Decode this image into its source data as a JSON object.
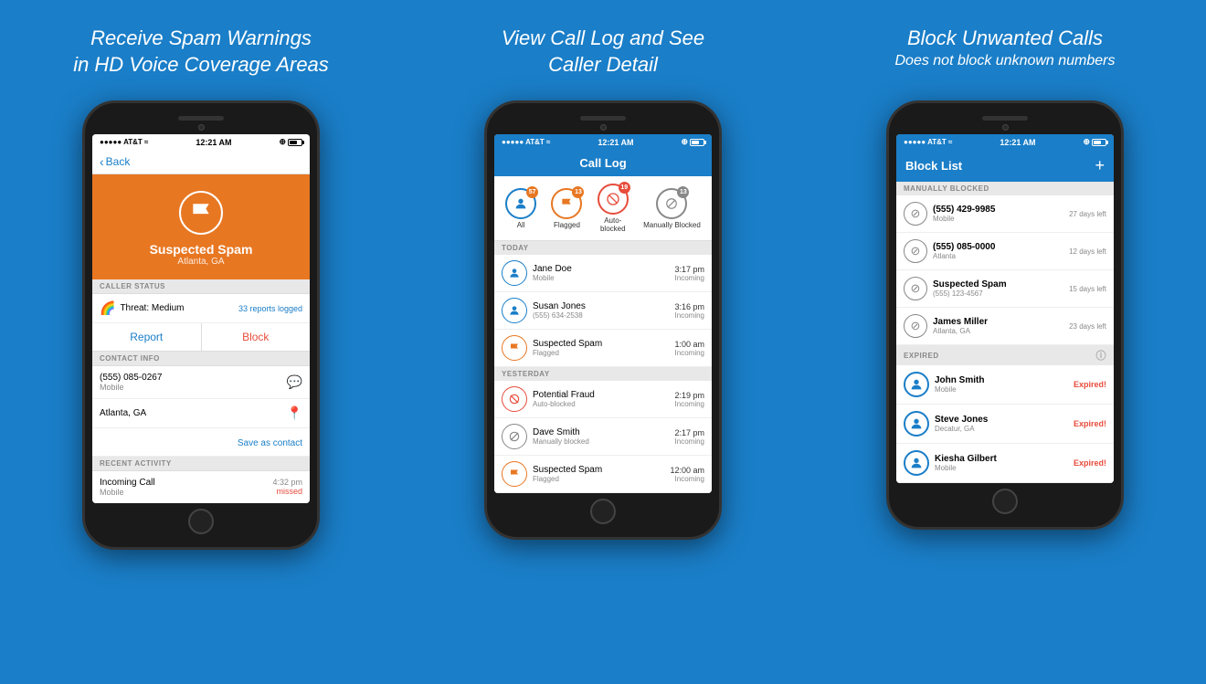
{
  "panels": [
    {
      "id": "panel1",
      "title_line1": "Receive Spam Warnings",
      "title_line2": "in HD Voice Coverage Areas",
      "phone": {
        "status_bar": {
          "carrier": "AT&T",
          "time": "12:21 AM",
          "signal": "●●●●●"
        },
        "nav": {
          "back_label": "Back"
        },
        "caller_header": {
          "name": "Suspected Spam",
          "location": "Atlanta, GA"
        },
        "sections": [
          {
            "label": "CALLER STATUS"
          },
          {
            "threat": "Threat: Medium",
            "reports": "33 reports logged"
          },
          {
            "report_label": "Report",
            "block_label": "Block"
          },
          {
            "label": "CONTACT INFO"
          },
          {
            "phone": "(555) 085-0267",
            "sub": "Mobile"
          },
          {
            "address": "Atlanta, GA"
          },
          {
            "save": "Save as contact"
          },
          {
            "label": "RECENT ACTIVITY"
          },
          {
            "activity": "Incoming Call",
            "sub": "Mobile",
            "time": "4:32 pm",
            "status": "missed"
          }
        ]
      }
    },
    {
      "id": "panel2",
      "title_line1": "View Call Log and See",
      "title_line2": "Caller Detail",
      "phone": {
        "status_bar": {
          "carrier": "AT&T",
          "time": "12:21 AM"
        },
        "nav": {
          "title": "Call Log"
        },
        "tabs": [
          {
            "label": "All",
            "badge": "57",
            "color": "blue",
            "badge_color": "orange"
          },
          {
            "label": "Flagged",
            "badge": "13",
            "color": "orange",
            "badge_color": "orange"
          },
          {
            "label": "Auto-blocked",
            "badge": "19",
            "color": "red",
            "badge_color": "red"
          },
          {
            "label": "Manually Blocked",
            "badge": "13",
            "color": "gray",
            "badge_color": "gray"
          }
        ],
        "today_calls": [
          {
            "name": "Jane Doe",
            "sub": "Mobile",
            "time": "3:17 pm",
            "direction": "Incoming",
            "type": "blue"
          },
          {
            "name": "Susan Jones",
            "sub": "(555) 634-2538",
            "time": "3:16 pm",
            "direction": "Incoming",
            "type": "blue"
          },
          {
            "name": "Suspected Spam",
            "sub": "Flagged",
            "time": "1:00 am",
            "direction": "Incoming",
            "type": "orange"
          }
        ],
        "yesterday_calls": [
          {
            "name": "Potential Fraud",
            "sub": "Auto-blocked",
            "time": "2:19 pm",
            "direction": "Incoming",
            "type": "red"
          },
          {
            "name": "Dave Smith",
            "sub": "Manually blocked",
            "time": "2:17 pm",
            "direction": "Incoming",
            "type": "gray"
          },
          {
            "name": "Suspected Spam",
            "sub": "Flagged",
            "time": "12:00 am",
            "direction": "Incoming",
            "type": "orange"
          }
        ]
      }
    },
    {
      "id": "panel3",
      "title_line1": "Block Unwanted Calls",
      "title_line2": "Does not block unknown numbers",
      "phone": {
        "status_bar": {
          "carrier": "AT&T",
          "time": "12:21 AM"
        },
        "nav": {
          "title": "Block List"
        },
        "manually_blocked": [
          {
            "name": "(555) 429-9985",
            "sub": "Mobile",
            "days": "27 days left"
          },
          {
            "name": "(555) 085-0000",
            "sub": "Atlanta",
            "days": "12 days left"
          },
          {
            "name": "Suspected Spam",
            "sub": "(555) 123-4567",
            "days": "15 days left"
          },
          {
            "name": "James Miller",
            "sub": "Atlanta, GA",
            "days": "23 days left"
          }
        ],
        "expired": [
          {
            "name": "John Smith",
            "sub": "Mobile",
            "badge": "Expired!"
          },
          {
            "name": "Steve Jones",
            "sub": "Decatur, GA",
            "badge": "Expired!"
          },
          {
            "name": "Kiesha Gilbert",
            "sub": "Mobile",
            "badge": "Expired!"
          }
        ]
      }
    }
  ],
  "colors": {
    "blue": "#1a7ec8",
    "orange": "#e87722",
    "red": "#e74c3c",
    "gray": "#888888",
    "background": "#1a7ec8"
  }
}
